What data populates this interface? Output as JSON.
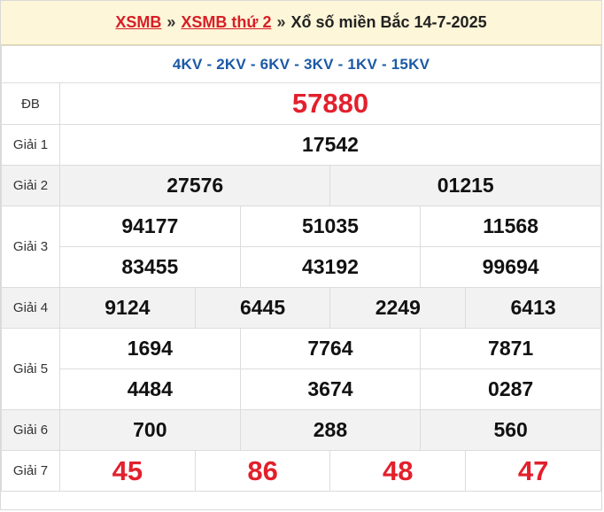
{
  "header": {
    "link1": "XSMB",
    "link2": "XSMB thứ 2",
    "sep": "»",
    "title": "Xổ số miền Bắc 14-7-2025"
  },
  "codes": "4KV - 2KV - 6KV - 3KV - 1KV - 15KV",
  "prizes": {
    "db": {
      "label": "ĐB",
      "values": [
        "57880"
      ]
    },
    "g1": {
      "label": "Giải 1",
      "values": [
        "17542"
      ]
    },
    "g2": {
      "label": "Giải 2",
      "values": [
        "27576",
        "01215"
      ]
    },
    "g3": {
      "label": "Giải 3",
      "values": [
        "94177",
        "51035",
        "11568",
        "83455",
        "43192",
        "99694"
      ]
    },
    "g4": {
      "label": "Giải 4",
      "values": [
        "9124",
        "6445",
        "2249",
        "6413"
      ]
    },
    "g5": {
      "label": "Giải 5",
      "values": [
        "1694",
        "7764",
        "7871",
        "4484",
        "3674",
        "0287"
      ]
    },
    "g6": {
      "label": "Giải 6",
      "values": [
        "700",
        "288",
        "560"
      ]
    },
    "g7": {
      "label": "Giải 7",
      "values": [
        "45",
        "86",
        "48",
        "47"
      ]
    }
  },
  "colors": {
    "accent_red": "#e2202c",
    "code_blue": "#1b5aa6",
    "header_bg": "#fdf6d8"
  }
}
